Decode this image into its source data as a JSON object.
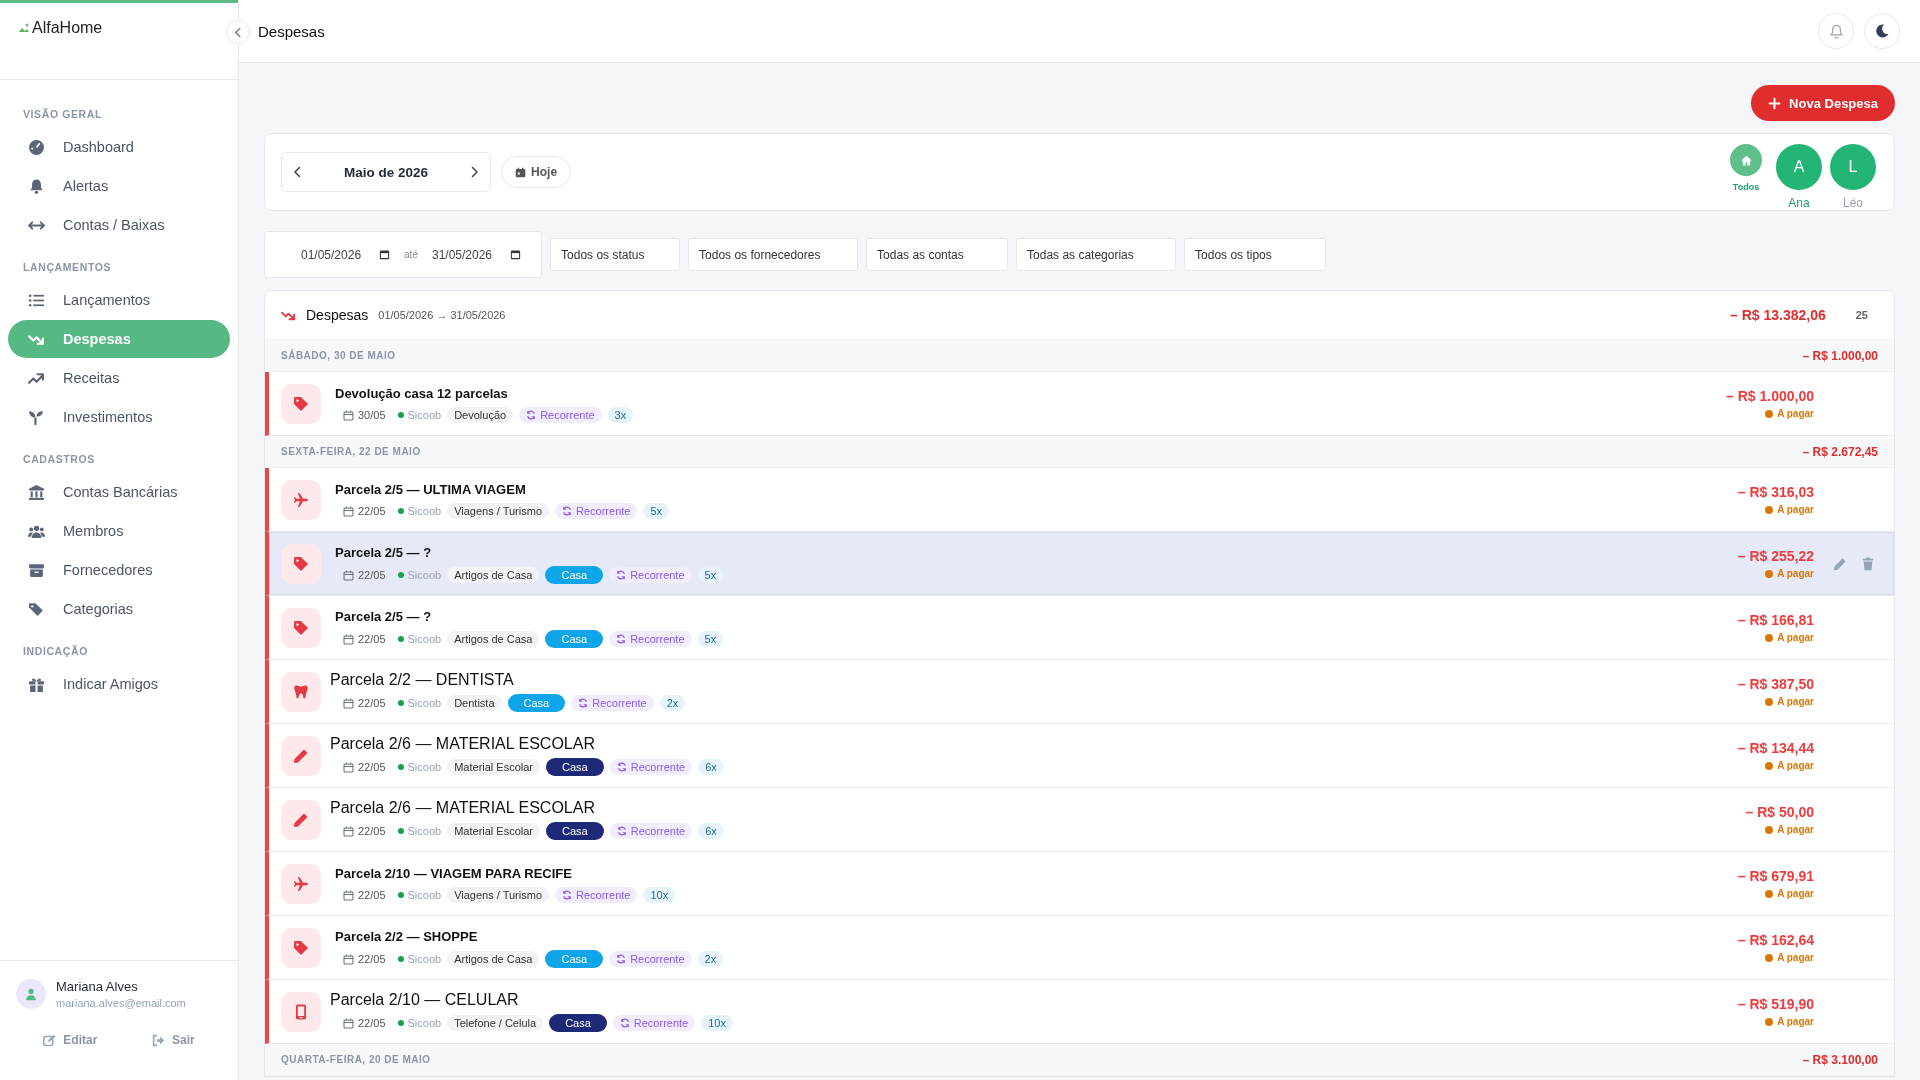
{
  "brand": {
    "name": "AlfaHome"
  },
  "sidebar": {
    "sections": [
      {
        "title": "VISÃO GERAL",
        "items": [
          {
            "label": "Dashboard",
            "kind": "gauge",
            "selected": false
          },
          {
            "label": "Alertas",
            "kind": "bell",
            "selected": false
          },
          {
            "label": "Contas / Baixas",
            "kind": "arrows",
            "selected": false
          }
        ]
      },
      {
        "title": "LANÇAMENTOS",
        "items": [
          {
            "label": "Lançamentos",
            "kind": "list",
            "selected": false
          },
          {
            "label": "Despesas",
            "kind": "down",
            "selected": true
          },
          {
            "label": "Receitas",
            "kind": "up",
            "selected": false
          },
          {
            "label": "Investimentos",
            "kind": "sprout",
            "selected": false
          }
        ]
      },
      {
        "title": "CADASTROS",
        "items": [
          {
            "label": "Contas Bancárias",
            "kind": "bank",
            "selected": false
          },
          {
            "label": "Membros",
            "kind": "users",
            "selected": false
          },
          {
            "label": "Fornecedores",
            "kind": "box",
            "selected": false
          },
          {
            "label": "Categorias",
            "kind": "tags",
            "selected": false
          }
        ]
      },
      {
        "title": "INDICAÇÃO",
        "items": [
          {
            "label": "Indicar Amigos",
            "kind": "gift",
            "selected": false
          }
        ]
      }
    ]
  },
  "user": {
    "name": "Mariana Alves",
    "email": "mariana.alves@email.com",
    "actions": [
      {
        "label": "Editar",
        "kind": "edit"
      },
      {
        "label": "Sair",
        "kind": "logout"
      }
    ]
  },
  "header": {
    "title": "Despesas"
  },
  "new_button": {
    "label": "Nova Despesa"
  },
  "period": {
    "label": "Maio de 2026",
    "today": "Hoje"
  },
  "members": [
    {
      "label": "Todos",
      "kind": "all",
      "active": true
    },
    {
      "label": "Ana",
      "initial": "A",
      "kind": "person",
      "active": true
    },
    {
      "label": "Léo",
      "initial": "L",
      "kind": "person",
      "active": false
    }
  ],
  "filters": {
    "date_from": "01/05/2026",
    "date_sep": "até",
    "date_to": "31/05/2026",
    "selects": [
      "Todos os status",
      "Todos os fornecedores",
      "Todas as contas",
      "Todas as categorias",
      "Todos os tipos"
    ]
  },
  "list": {
    "title": "Despesas",
    "range": "01/05/2026 → 31/05/2026",
    "total": "– R$ 13.382,06",
    "count": "25",
    "groups": [
      {
        "day": "SÁBADO, 30 DE MAIO",
        "total": "– R$ 1.000,00",
        "rows": [
          {
            "kind": "tag",
            "title": {
              "text": "Devolução casa 12 parcelas",
              "kind": "bold"
            },
            "date": "30/05",
            "account": "Sicoob",
            "category": "Devolução",
            "recurring": "Recorrente",
            "installments": "3x",
            "amount": "– R$ 1.000,00",
            "status": "A pagar",
            "hovered": false
          }
        ]
      },
      {
        "day": "SEXTA-FEIRA, 22 DE MAIO",
        "total": "– R$ 2.672,45",
        "rows": [
          {
            "kind": "plane",
            "title": {
              "text": "Parcela 2/5 — ULTIMA VIAGEM",
              "kind": "bold"
            },
            "date": "22/05",
            "account": "Sicoob",
            "category": "Viagens / Turismo",
            "recurring": "Recorrente",
            "installments": "5x",
            "amount": "– R$ 316,03",
            "status": "A pagar",
            "hovered": false
          },
          {
            "kind": "tag",
            "title": {
              "text": "Parcela 2/5 — ?",
              "kind": "bold"
            },
            "date": "22/05",
            "account": "Sicoob",
            "category": "Artigos de Casa",
            "member_tag": {
              "label": "Casa",
              "color": "#0ea5e9"
            },
            "recurring": "Recorrente",
            "installments": "5x",
            "amount": "– R$ 255,22",
            "status": "A pagar",
            "hovered": true
          },
          {
            "kind": "tag",
            "title": {
              "text": "Parcela 2/5 — ?",
              "kind": "bold"
            },
            "date": "22/05",
            "account": "Sicoob",
            "category": "Artigos de Casa",
            "member_tag": {
              "label": "Casa",
              "color": "#0ea5e9"
            },
            "recurring": "Recorrente",
            "installments": "5x",
            "amount": "– R$ 166,81",
            "status": "A pagar",
            "hovered": false
          },
          {
            "kind": "tooth",
            "title": {
              "text": "Parcela 2/2 — DENTISTA",
              "kind": "large"
            },
            "date": "22/05",
            "account": "Sicoob",
            "category": "Dentista",
            "member_tag": {
              "label": "Casa",
              "color": "#0ea5e9"
            },
            "recurring": "Recorrente",
            "installments": "2x",
            "amount": "– R$ 387,50",
            "status": "A pagar",
            "hovered": false
          },
          {
            "kind": "pencil",
            "title": {
              "text": "Parcela 2/6 — MATERIAL ESCOLAR",
              "kind": "large"
            },
            "date": "22/05",
            "account": "Sicoob",
            "category": "Material Escolar",
            "member_tag": {
              "label": "Casa",
              "color": "#1e2a78"
            },
            "recurring": "Recorrente",
            "installments": "6x",
            "amount": "– R$ 134,44",
            "status": "A pagar",
            "hovered": false
          },
          {
            "kind": "pencil",
            "title": {
              "text": "Parcela 2/6 — MATERIAL ESCOLAR",
              "kind": "large"
            },
            "date": "22/05",
            "account": "Sicoob",
            "category": "Material Escolar",
            "member_tag": {
              "label": "Casa",
              "color": "#1e2a78"
            },
            "recurring": "Recorrente",
            "installments": "6x",
            "amount": "– R$ 50,00",
            "status": "A pagar",
            "hovered": false
          },
          {
            "kind": "plane",
            "title": {
              "text": "Parcela 2/10 — VIAGEM PARA RECIFE",
              "kind": "bold"
            },
            "date": "22/05",
            "account": "Sicoob",
            "category": "Viagens / Turismo",
            "recurring": "Recorrente",
            "installments": "10x",
            "amount": "– R$ 679,91",
            "status": "A pagar",
            "hovered": false
          },
          {
            "kind": "tag",
            "title": {
              "text": "Parcela 2/2 — SHOPPE",
              "kind": "bold"
            },
            "date": "22/05",
            "account": "Sicoob",
            "category": "Artigos de Casa",
            "member_tag": {
              "label": "Casa",
              "color": "#0ea5e9"
            },
            "recurring": "Recorrente",
            "installments": "2x",
            "amount": "– R$ 162,64",
            "status": "A pagar",
            "hovered": false
          },
          {
            "kind": "phone",
            "title": {
              "text": "Parcela 2/10 — CELULAR",
              "kind": "large"
            },
            "date": "22/05",
            "account": "Sicoob",
            "category": "Telefone / Celula",
            "member_tag": {
              "label": "Casa",
              "color": "#1e2a78"
            },
            "recurring": "Recorrente",
            "installments": "10x",
            "amount": "– R$ 519,90",
            "status": "A pagar",
            "hovered": false
          }
        ]
      },
      {
        "day": "QUARTA-FEIRA, 20 DE MAIO",
        "total": "– R$ 3.100,00"
      }
    ]
  }
}
